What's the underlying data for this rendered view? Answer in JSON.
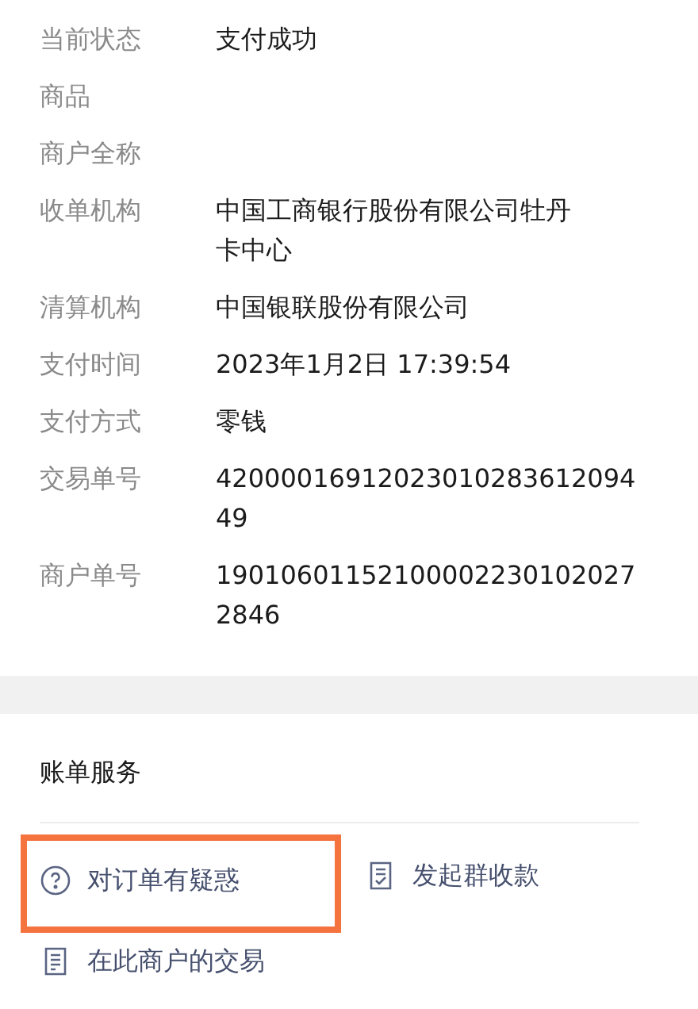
{
  "details": [
    {
      "label": "当前状态",
      "lines": [
        "支付成功"
      ]
    },
    {
      "label": "商品"
    },
    {
      "label": "商户全称"
    },
    {
      "label": "收单机构",
      "lines": [
        "中国工商银行股份有限公司牡丹",
        "卡中心"
      ]
    },
    {
      "label": "清算机构",
      "lines": [
        "中国银联股份有限公司"
      ]
    },
    {
      "label": "支付时间",
      "lines": [
        "2023年1月2日 17:39:54"
      ]
    },
    {
      "label": "支付方式",
      "lines": [
        "零钱"
      ]
    },
    {
      "label": "交易单号",
      "lines": [
        "42000016912023010283612094",
        "49"
      ]
    },
    {
      "label": "商户单号",
      "lines": [
        "19010601152100002230102027",
        "2846"
      ]
    }
  ],
  "services": {
    "title": "账单服务",
    "items": [
      {
        "label": "对订单有疑惑",
        "kind": "question",
        "highlighted": true
      },
      {
        "label": "发起群收款",
        "kind": "checklist",
        "highlighted": false
      },
      {
        "label": "在此商户的交易",
        "kind": "document",
        "highlighted": false
      }
    ]
  }
}
